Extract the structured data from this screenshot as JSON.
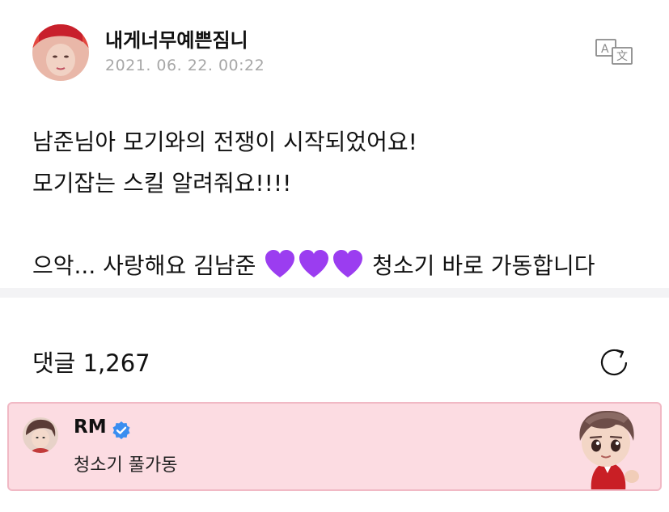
{
  "post": {
    "author": "내게너무예쁜짐니",
    "timestamp": "2021. 06. 22. 00:22",
    "translate_icon": "translate-icon",
    "lines": [
      "남준님아 모기와의 전쟁이 시작되었어요!",
      "모기잡는 스킬 알려줘요!!!!"
    ],
    "last_line_before": "으악... 사랑해요 김남준",
    "hearts": [
      "purple-heart-icon",
      "purple-heart-icon",
      "purple-heart-icon"
    ],
    "last_line_after": "청소기 바로 가동합니다"
  },
  "comments": {
    "title": "댓글 1,267",
    "refresh_icon": "refresh-icon",
    "highlighted": {
      "name": "RM",
      "verified_icon": "verified-badge-icon",
      "text": "청소기 풀가동"
    }
  },
  "colors": {
    "highlight_bg": "#fcdce2",
    "highlight_border": "#f1b9c5",
    "heart": "#9b3df0",
    "verified": "#3a8ef0",
    "timestamp": "#a7a7a7"
  }
}
